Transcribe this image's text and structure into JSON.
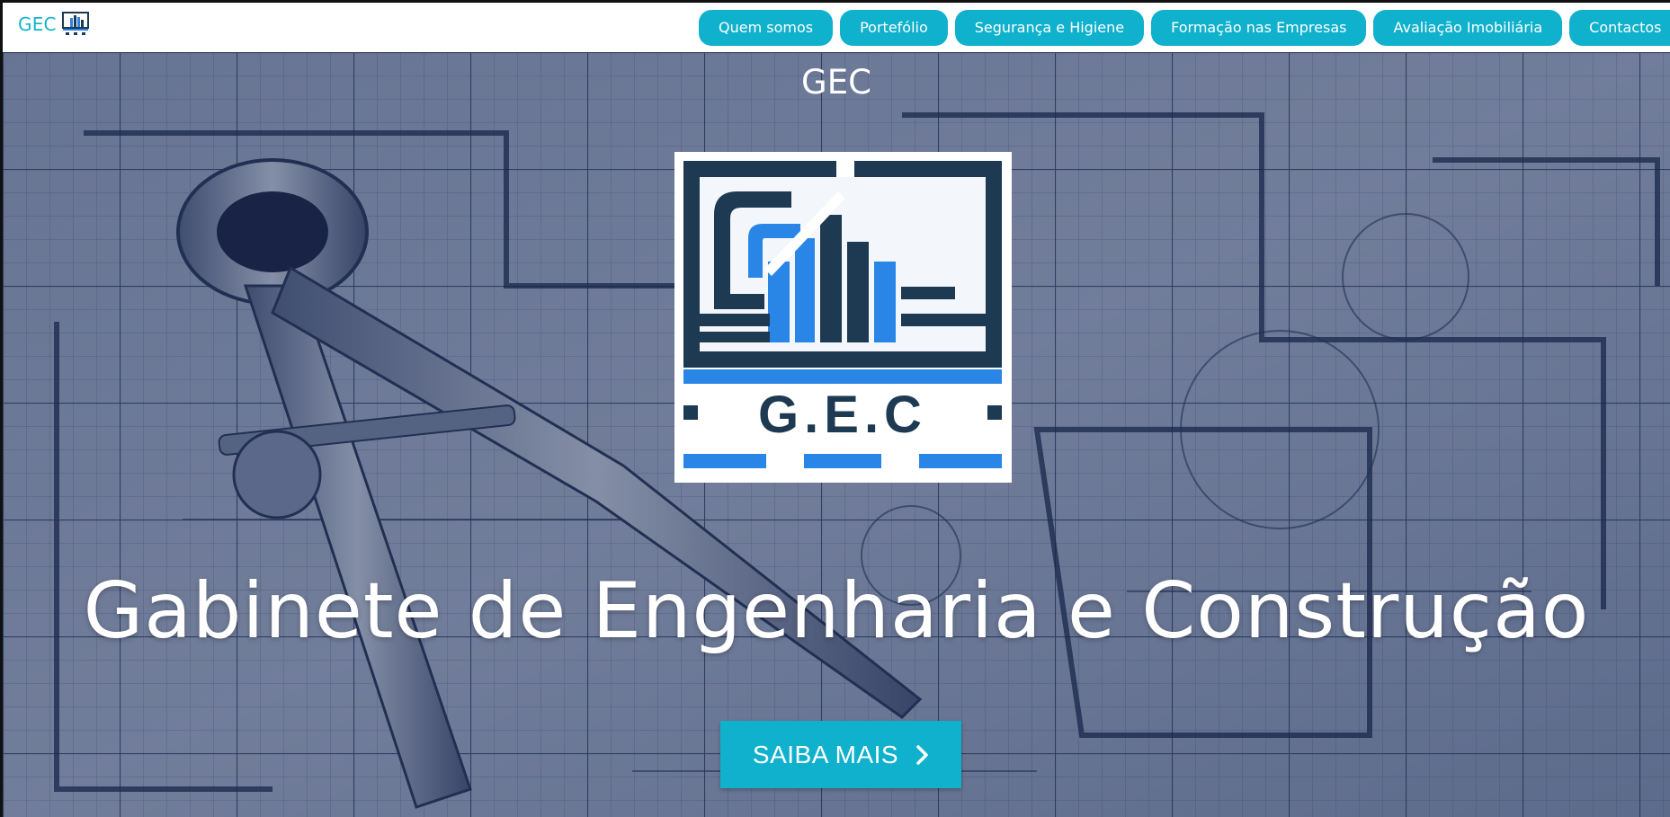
{
  "brand": {
    "name": "GEC",
    "logo_icon": "gec-building-logo-icon"
  },
  "nav": {
    "items": [
      {
        "label": "Quem somos"
      },
      {
        "label": "Portefólio"
      },
      {
        "label": "Segurança e Higiene"
      },
      {
        "label": "Formação nas Empresas"
      },
      {
        "label": "Avaliação Imobiliária"
      },
      {
        "label": "Contactos"
      }
    ]
  },
  "hero": {
    "small_title": "GEC",
    "logo_text": "G.E.C",
    "heading": "Gabinete de Engenharia e Construção",
    "cta_label": "SAIBA MAIS",
    "cta_icon": "chevron-right-icon",
    "background": "blueprint-with-compass-image"
  },
  "colors": {
    "accent": "#10b1cc",
    "logo_dark": "#1d3a52",
    "logo_blue": "#2a86e6"
  }
}
